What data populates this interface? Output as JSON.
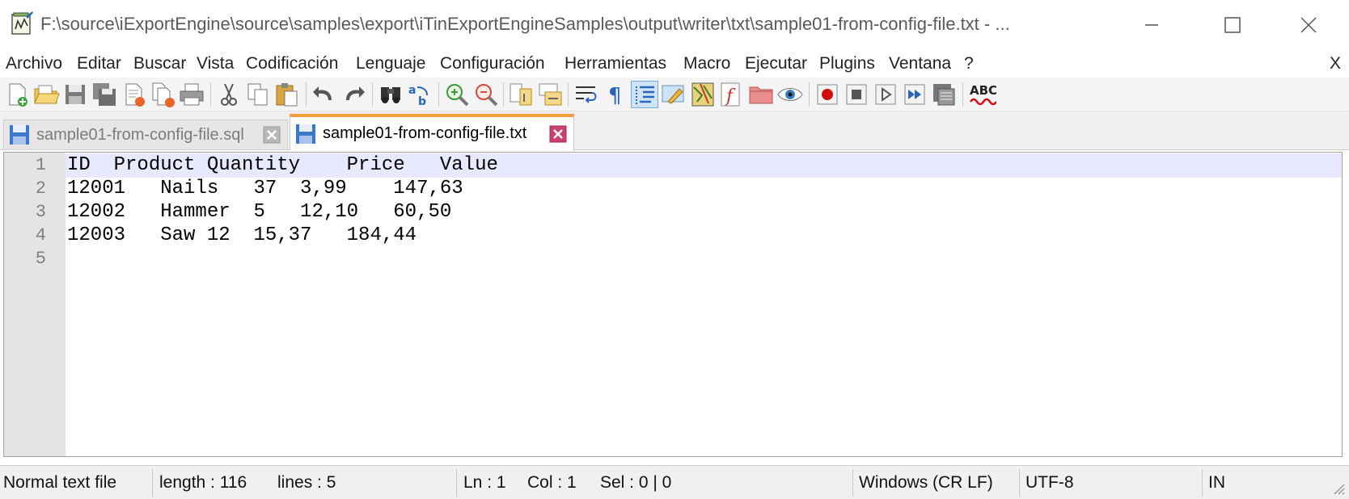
{
  "window": {
    "title": "F:\\source\\iExportEngine\\source\\samples\\export\\iTinExportEngineSamples\\output\\writer\\txt\\sample01-from-config-file.txt - ..."
  },
  "menu": {
    "items": [
      "Archivo",
      "Editar",
      "Buscar",
      "Vista",
      "Codificación",
      "Lenguaje",
      "Configuración",
      "Herramientas",
      "Macro",
      "Ejecutar",
      "Plugins",
      "Ventana",
      "?"
    ],
    "close_label": "X"
  },
  "toolbar": {
    "icons": [
      "new-file-icon",
      "open-file-icon",
      "save-icon",
      "save-all-icon",
      "close-icon",
      "close-all-icon",
      "print-icon",
      "cut-icon",
      "copy-icon",
      "paste-icon",
      "undo-icon",
      "redo-icon",
      "find-icon",
      "replace-icon",
      "zoom-in-icon",
      "zoom-out-icon",
      "sync-vertical-icon",
      "sync-horizontal-icon",
      "word-wrap-icon",
      "show-all-characters-icon",
      "indent-guide-icon",
      "user-language-icon",
      "document-map-icon",
      "function-list-icon",
      "folder-as-workspace-icon",
      "monitoring-icon",
      "record-macro-icon",
      "stop-macro-icon",
      "play-macro-icon",
      "run-macro-multiple-icon",
      "save-macro-icon",
      "spell-check-icon"
    ],
    "spellcheck_label": "ABC"
  },
  "tabs": [
    {
      "label": "sample01-from-config-file.sql",
      "active": false
    },
    {
      "label": "sample01-from-config-file.txt",
      "active": true
    }
  ],
  "editor": {
    "line_numbers": [
      "1",
      "2",
      "3",
      "4",
      "5"
    ],
    "lines": [
      "ID  Product Quantity    Price   Value",
      "12001   Nails   37  3,99    147,63",
      "12002   Hammer  5   12,10   60,50",
      "12003   Saw 12  15,37   184,44",
      ""
    ]
  },
  "status": {
    "file_type": "Normal text file",
    "length": "length : 116",
    "lines": "lines : 5",
    "ln": "Ln : 1",
    "col": "Col : 1",
    "sel": "Sel : 0 | 0",
    "eol": "Windows (CR LF)",
    "encoding": "UTF-8",
    "mode": "IN"
  },
  "colors": {
    "active_tab_accent": "#fa9a3c",
    "current_line": "#e8e8ff",
    "gutter": "#e4e4e4",
    "statusbar": "#f0f0f0"
  }
}
